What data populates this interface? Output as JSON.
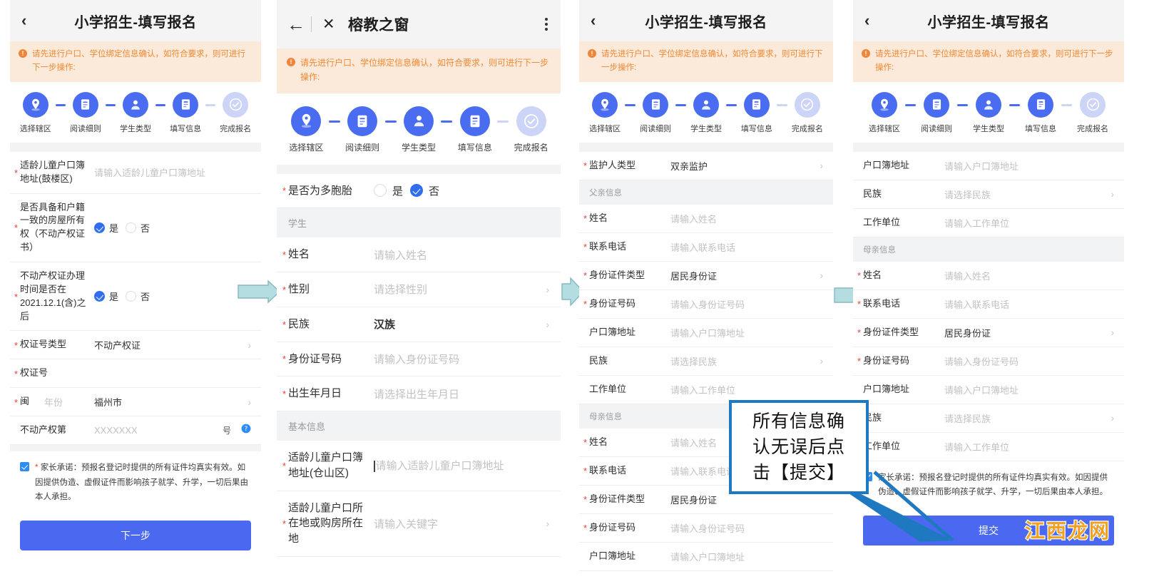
{
  "common": {
    "app_title": "小学招生-填写报名",
    "notice_text": "请先进行户口、学位绑定信息确认，如符合要求，则可进行下一步操作:",
    "notice_icon": "info-icon",
    "back_icon": "‹",
    "steps": [
      {
        "label": "选择辖区",
        "icon": "location-pin-icon",
        "state": "active"
      },
      {
        "label": "阅读细则",
        "icon": "document-lines-icon",
        "state": "active"
      },
      {
        "label": "学生类型",
        "icon": "user-avatar-icon",
        "state": "active"
      },
      {
        "label": "填写信息",
        "icon": "form-edit-icon",
        "state": "active"
      },
      {
        "label": "完成报名",
        "icon": "check-circle-icon",
        "state": "dim"
      }
    ],
    "chevron": "›",
    "promise": {
      "required_mark": "*",
      "text": "家长承诺：预报名登记时提供的所有证件均真实有效。如因提供伪造、虚假证件而影响孩子就学、升学，一切后果由本人承担。",
      "checked": true
    }
  },
  "panel1": {
    "title": "小学招生-填写报名",
    "rows": [
      {
        "label": "适龄儿童户口簿地址(鼓楼区)",
        "required": true,
        "placeholder": "请输入适龄儿童户口簿地址",
        "type": "input"
      },
      {
        "label": "是否具备和户籍一致的房屋所有权（不动产权证书）",
        "required": true,
        "type": "radio",
        "options": [
          "是",
          "否"
        ],
        "selected": "是"
      },
      {
        "label": "不动产权证办理时间是否在2021.12.1(含)之后",
        "required": true,
        "type": "radio",
        "options": [
          "是",
          "否"
        ],
        "selected": "是"
      },
      {
        "label": "权证号类型",
        "required": true,
        "value": "不动产权证",
        "type": "select"
      },
      {
        "label": "权证号",
        "required": true,
        "value": "",
        "type": "input"
      },
      {
        "label": "闽",
        "required": true,
        "sublabel": "年份",
        "value": "福州市",
        "type": "select"
      },
      {
        "label": "不动产权第",
        "required": false,
        "placeholder": "XXXXXXX",
        "suffix": "号",
        "help_icon": "question-circle-icon",
        "type": "input"
      }
    ],
    "submit_label": "下一步"
  },
  "panel2": {
    "title": "榕教之窗",
    "back_icon": "←",
    "close_icon": "✕",
    "menu_icon": "kebab-menu-icon",
    "rows_top": [
      {
        "label": "是否为多胞胎",
        "required": true,
        "type": "radio",
        "options": [
          "是",
          "否"
        ],
        "selected": "否"
      }
    ],
    "group_student": "学生",
    "rows_student": [
      {
        "label": "姓名",
        "required": true,
        "placeholder": "请输入姓名",
        "type": "input"
      },
      {
        "label": "性别",
        "required": true,
        "placeholder": "请选择性别",
        "type": "select"
      },
      {
        "label": "民族",
        "required": true,
        "value": "汉族",
        "type": "select"
      },
      {
        "label": "身份证号码",
        "required": true,
        "placeholder": "请输入身份证号码",
        "type": "input"
      },
      {
        "label": "出生年月日",
        "required": true,
        "placeholder": "请选择出生年月日",
        "type": "select"
      }
    ],
    "group_basic": "基本信息",
    "rows_basic": [
      {
        "label": "适龄儿童户口簿地址(仓山区)",
        "required": true,
        "placeholder": "请输入适龄儿童户口簿地址",
        "type": "input",
        "focused": true
      },
      {
        "label": "适龄儿童户口所在地或购房所在地",
        "required": true,
        "placeholder": "请输入关键字",
        "type": "select"
      }
    ]
  },
  "panel3": {
    "title": "小学招生-填写报名",
    "rows_top": [
      {
        "label": "监护人类型",
        "required": true,
        "value": "双亲监护",
        "type": "select"
      }
    ],
    "group_father": "父亲信息",
    "rows_father": [
      {
        "label": "姓名",
        "required": true,
        "placeholder": "请输入姓名",
        "type": "input"
      },
      {
        "label": "联系电话",
        "required": true,
        "placeholder": "请输入联系电话",
        "type": "input"
      },
      {
        "label": "身份证件类型",
        "required": true,
        "value": "居民身份证",
        "type": "select"
      },
      {
        "label": "身份证号码",
        "required": true,
        "placeholder": "请输入身份证号码",
        "type": "input"
      },
      {
        "label": "户口簿地址",
        "required": false,
        "placeholder": "请输入户口簿地址",
        "type": "input"
      },
      {
        "label": "民族",
        "required": false,
        "placeholder": "请选择民族",
        "type": "select"
      },
      {
        "label": "工作单位",
        "required": false,
        "placeholder": "请输入工作单位",
        "type": "input"
      }
    ],
    "group_mother": "母亲信息",
    "rows_mother": [
      {
        "label": "姓名",
        "required": true,
        "placeholder": "请输入姓名",
        "type": "input"
      },
      {
        "label": "联系电话",
        "required": true,
        "placeholder": "请输入联系电话",
        "type": "input"
      },
      {
        "label": "身份证件类型",
        "required": true,
        "value": "居民身份证",
        "type": "select"
      },
      {
        "label": "身份证号码",
        "required": true,
        "placeholder": "请输入身份证号码",
        "type": "input"
      },
      {
        "label": "户口簿地址",
        "required": false,
        "placeholder": "请输入户口簿地址",
        "type": "input"
      }
    ]
  },
  "panel4": {
    "title": "小学招生-填写报名",
    "rows_father_tail": [
      {
        "label": "户口簿地址",
        "required": false,
        "placeholder": "请输入户口簿地址",
        "type": "input"
      },
      {
        "label": "民族",
        "required": false,
        "placeholder": "请选择民族",
        "type": "select"
      },
      {
        "label": "工作单位",
        "required": false,
        "placeholder": "请输入工作单位",
        "type": "input"
      }
    ],
    "group_mother": "母亲信息",
    "rows_mother": [
      {
        "label": "姓名",
        "required": true,
        "placeholder": "请输入姓名",
        "type": "input"
      },
      {
        "label": "联系电话",
        "required": true,
        "placeholder": "请输入联系电话",
        "type": "input"
      },
      {
        "label": "身份证件类型",
        "required": true,
        "value": "居民身份证",
        "type": "select"
      },
      {
        "label": "身份证号码",
        "required": true,
        "placeholder": "请输入身份证号码",
        "type": "input"
      },
      {
        "label": "户口簿地址",
        "required": false,
        "placeholder": "请输入户口簿地址",
        "type": "input"
      },
      {
        "label": "民族",
        "required": false,
        "placeholder": "请选择民族",
        "type": "select"
      },
      {
        "label": "工作单位",
        "required": false,
        "placeholder": "请输入工作单位",
        "type": "input"
      }
    ],
    "submit_label": "提交"
  },
  "annotation": {
    "callout_lines": [
      "所有信息确",
      "认无误后点",
      "击【提交】"
    ],
    "border_color": "#1f79c0"
  },
  "watermark": {
    "text": "江西龙网",
    "color": "#f2a020"
  },
  "colors": {
    "primary": "#4a69f0",
    "notice_bg": "#fbe9d9",
    "notice_text": "#f08a34",
    "arrow": "#b4dde2",
    "required": "#e8413c"
  }
}
